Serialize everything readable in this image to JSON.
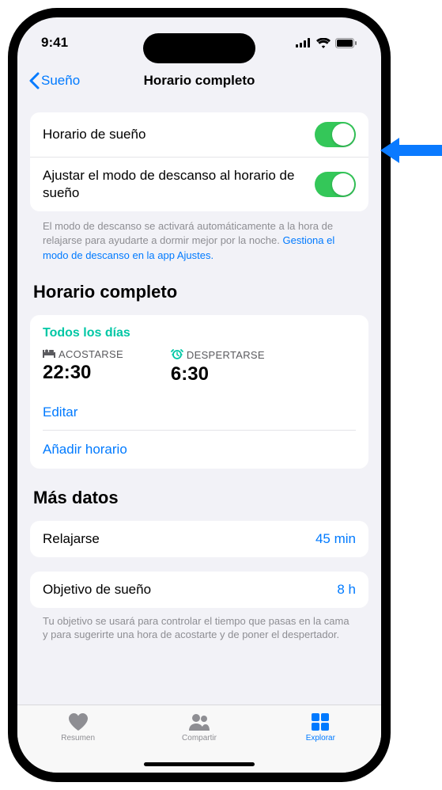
{
  "statusBar": {
    "time": "9:41"
  },
  "nav": {
    "back": "Sueño",
    "title": "Horario completo"
  },
  "toggles": {
    "sleepSchedule": {
      "label": "Horario de sueño",
      "on": true
    },
    "windDown": {
      "label": "Ajustar el modo de descanso al horario de sueño",
      "on": true
    }
  },
  "footerHint": {
    "text": "El modo de descanso se activará automáticamente a la hora de relajarse para ayudarte a dormir mejor por la noche. ",
    "link": "Gestiona el modo de descanso en la app Ajustes."
  },
  "sections": {
    "fullSchedule": "Horario completo",
    "moreData": "Más datos"
  },
  "schedule": {
    "days": "Todos los días",
    "bedtimeLabel": "ACOSTARSE",
    "bedtimeValue": "22:30",
    "wakeLabel": "DESPERTARSE",
    "wakeValue": "6:30",
    "edit": "Editar",
    "add": "Añadir horario"
  },
  "moreData": {
    "windDown": {
      "label": "Relajarse",
      "value": "45 min"
    },
    "sleepGoal": {
      "label": "Objetivo de sueño",
      "value": "8 h"
    },
    "footer": "Tu objetivo se usará para controlar el tiempo que pasas en la cama y para sugerirte una hora de acostarte y de poner el despertador."
  },
  "tabs": {
    "summary": "Resumen",
    "sharing": "Compartir",
    "browse": "Explorar"
  }
}
